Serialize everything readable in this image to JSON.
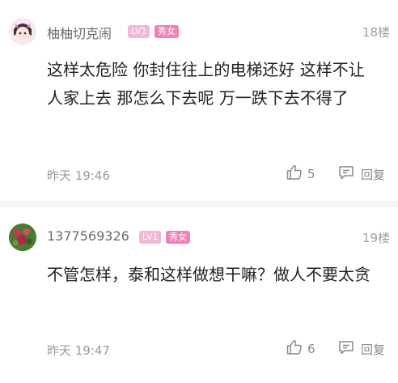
{
  "comments": [
    {
      "username": "柚柚切克闹",
      "level": "LV1",
      "gender": "秀女",
      "floor": "18楼",
      "content": "这样太危险 你封住往上的电梯还好 这样不让人家上去 那怎么下去呢 万一跌下去不得了",
      "time": "昨天 19:46",
      "likes": "5",
      "reply_label": "回复"
    },
    {
      "username": "1377569326",
      "level": "LV1",
      "gender": "秀女",
      "floor": "19楼",
      "content": "不管怎样，泰和这样做想干嘛？做人不要太贪",
      "time": "昨天 19:47",
      "likes": "6",
      "reply_label": "回复"
    }
  ],
  "colors": {
    "level_badge": "#f2b9d4",
    "gender_badge": "#f57fb8",
    "meta_text": "#9a9a9a"
  },
  "icons": {
    "like": "thumbs-up-icon",
    "reply": "comment-bubble-icon"
  }
}
